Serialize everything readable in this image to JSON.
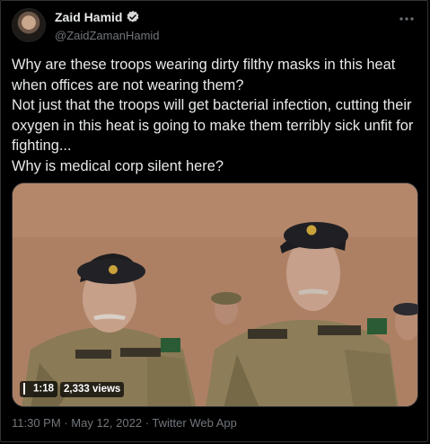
{
  "tweet": {
    "author": {
      "display_name": "Zaid Hamid",
      "handle": "@ZaidZamanHamid",
      "verified": true
    },
    "text": "Why are these troops wearing dirty filthy masks in this heat when offices are not wearing them?\nNot just that the troops will get bacterial infection, cutting their oxygen in this heat is going to make them terribly sick unfit for fighting...\nWhy is medical corp silent here?",
    "media": {
      "type": "video",
      "duration": "1:18",
      "views": "2,333 views",
      "name_tags": [
        "NASIR",
        "PAK ARMY",
        "BABAR",
        "PAK ARMY"
      ]
    },
    "meta": {
      "time": "11:30 PM",
      "separator": "·",
      "date": "May 12, 2022",
      "source": "Twitter Web App"
    }
  },
  "colors": {
    "background": "#000000",
    "text": "#e7e9ea",
    "secondary": "#71767b",
    "verified": "#d9d9d9"
  },
  "icons": [
    "verified-badge-icon",
    "more-options-icon",
    "mute-icon"
  ]
}
